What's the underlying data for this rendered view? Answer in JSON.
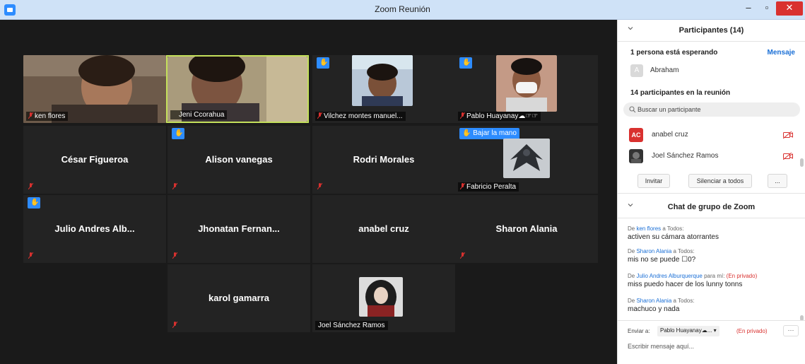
{
  "window": {
    "title": "Zoom Reunión",
    "minimize": "–",
    "maximize": "▫",
    "close": "✕"
  },
  "video": {
    "tiles": [
      {
        "name": "ken flores"
      },
      {
        "name": "Jeni Ccorahua"
      },
      {
        "name": "Vilchez montes manuel..."
      },
      {
        "name": "Pablo Huayanay☁☞☞"
      },
      {
        "name": "César Figueroa"
      },
      {
        "name": "Alison vanegas"
      },
      {
        "name": "Rodri Morales"
      },
      {
        "name": "Fabricio Peralta",
        "hand_label": "Bajar la mano"
      },
      {
        "name": "Julio Andres Alb..."
      },
      {
        "name": "Jhonatan  Fernan..."
      },
      {
        "name": "anabel cruz"
      },
      {
        "name": "Sharon Alania"
      },
      {
        "name": "karol gamarra"
      },
      {
        "name": "Joel Sánchez Ramos"
      }
    ]
  },
  "participants": {
    "header": "Participantes (14)",
    "waiting_label": "1 persona está esperando",
    "message_link": "Mensaje",
    "waiting": {
      "initial": "A",
      "name": "Abraham"
    },
    "in_meeting_label": "14 participantes en la reunión",
    "search_placeholder": "Buscar un participante",
    "list": [
      {
        "initials": "AC",
        "name": "anabel cruz",
        "avatar_color": "#d9312f"
      },
      {
        "initials": "",
        "name": "Joel Sánchez Ramos",
        "avatar_color": "#333333"
      }
    ],
    "buttons": {
      "invite": "Invitar",
      "mute_all": "Silenciar a todos",
      "more": "..."
    }
  },
  "chat": {
    "header": "Chat de grupo de Zoom",
    "messages": [
      {
        "prefix": "De ",
        "sender": "ken flores",
        "to": " a Todos:",
        "private": "",
        "text": "activen su cámara atorrantes"
      },
      {
        "prefix": "De ",
        "sender": "Sharon Alania",
        "to": " a Todos:",
        "private": "",
        "text": "mis no se puede ☐0?"
      },
      {
        "prefix": "De ",
        "sender": "Julio Andres Alburquerque",
        "to": " para mí:",
        "private": " (En privado)",
        "text": "miss puedo hacer de los lunny tonns"
      },
      {
        "prefix": "De ",
        "sender": "Sharon Alania",
        "to": " a Todos:",
        "private": "",
        "text": "machuco y nada"
      }
    ],
    "send_to_label": "Enviar a:",
    "send_to_value": "Pablo Huayanay☁... ▾",
    "send_to_private": "(En privado)",
    "more": "···",
    "input_placeholder": "Escribir mensaje aquí..."
  },
  "colors": {
    "accent": "#2d8cff",
    "active_speaker": "#c4e05b",
    "mute_red": "#d9312f",
    "link_blue": "#1a6fd6"
  }
}
